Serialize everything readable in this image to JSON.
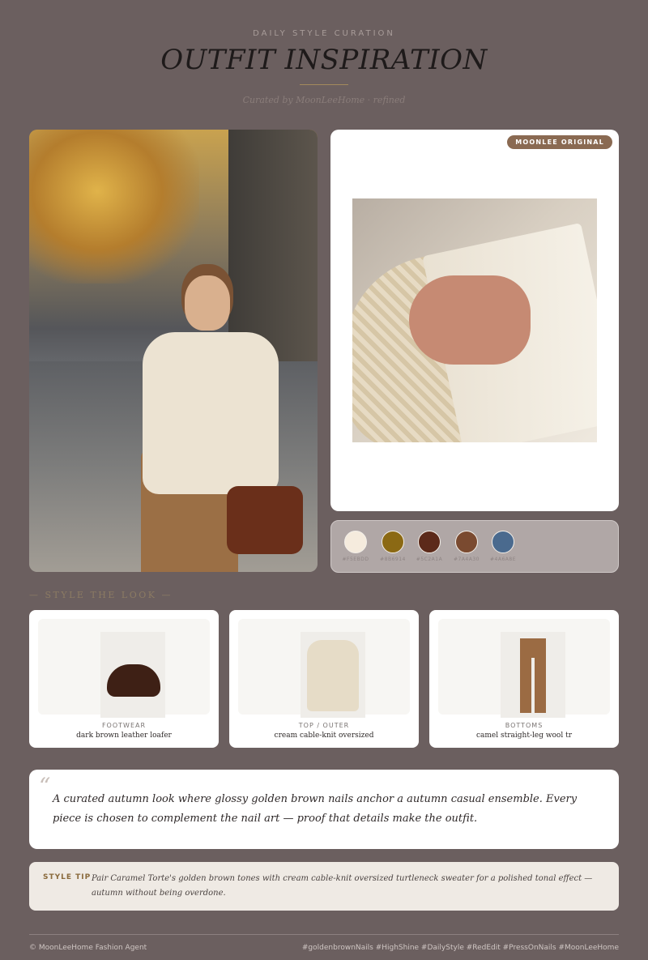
{
  "header": {
    "eyebrow": "DAILY STYLE CURATION",
    "title": "OUTFIT INSPIRATION",
    "subtitle": "Curated by MoonLeeHome · refined"
  },
  "badge": {
    "label": "MOONLEE ORIGINAL"
  },
  "palette": {
    "swatches": [
      {
        "color": "#F5EBDD",
        "label": "#F5EBDD"
      },
      {
        "color": "#8B6914",
        "label": "#8B6914"
      },
      {
        "color": "#5C2A1A",
        "label": "#5C2A1A"
      },
      {
        "color": "#7A4A30",
        "label": "#7A4A30"
      },
      {
        "color": "#4A6A8E",
        "label": "#4A6A8E"
      }
    ]
  },
  "section": {
    "label": "— STYLE THE LOOK —"
  },
  "products": [
    {
      "category": "FOOTWEAR",
      "name": "dark brown leather loafer",
      "icon": "loafer-icon"
    },
    {
      "category": "TOP / OUTER",
      "name": "cream cable-knit oversized",
      "icon": "sweater-icon"
    },
    {
      "category": "BOTTOMS",
      "name": "camel straight-leg wool tr",
      "icon": "trousers-icon"
    }
  ],
  "quote": {
    "mark": "“",
    "text": "A curated autumn look where glossy golden brown nails anchor a autumn casual ensemble. Every piece is chosen to complement the nail art — proof that details make the outfit."
  },
  "tip": {
    "label": "STYLE TIP",
    "text": "Pair Caramel Torte's golden brown tones with cream cable-knit oversized turtleneck sweater for a polished tonal effect — autumn without being overdone."
  },
  "footer": {
    "left": "© MoonLeeHome Fashion Agent",
    "right": "#goldenbrownNails #HighShine #DailyStyle #RedEdit #PressOnNails #MoonLeeHome"
  }
}
